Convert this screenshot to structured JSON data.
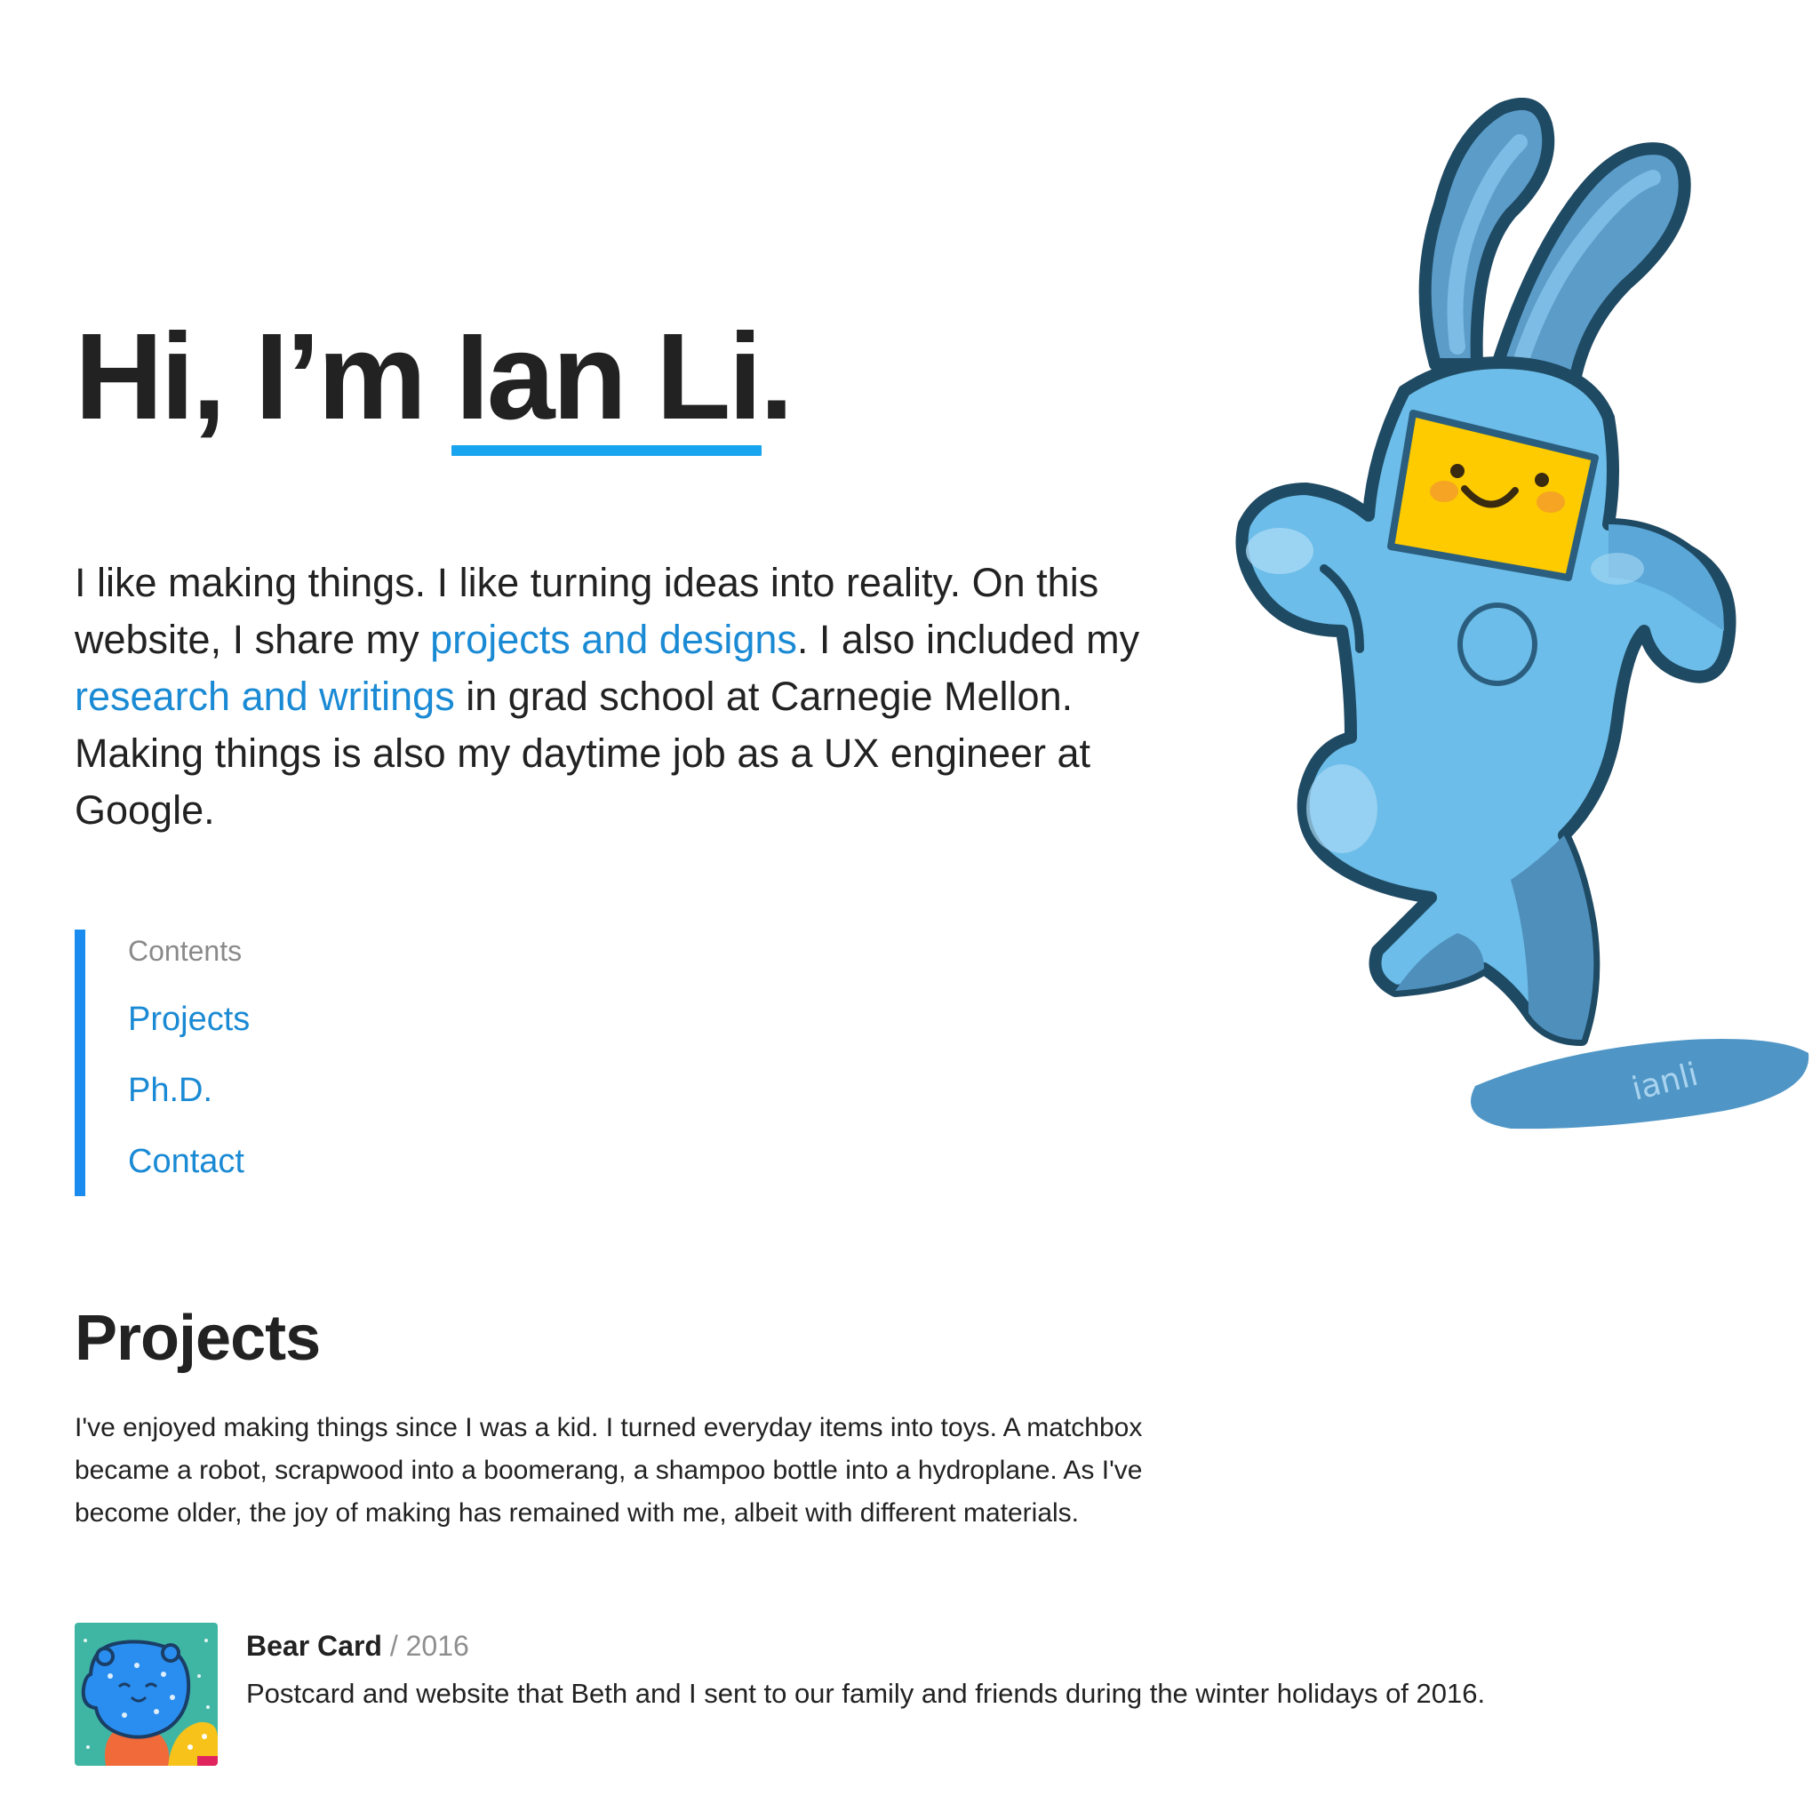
{
  "hero": {
    "greeting": "Hi, I’m ",
    "name": "Ian Li",
    "period": "."
  },
  "intro": {
    "p1": "I like making things. I like turning ideas into reality. On this website, I share my ",
    "link1": "projects and designs",
    "p2": ". I also included my ",
    "link2": "research and writings",
    "p3": " in grad school at Carnegie Mellon. Making things is also my daytime job as a UX engineer at Google."
  },
  "toc": {
    "heading": "Contents",
    "items": [
      {
        "label": "Projects"
      },
      {
        "label": "Ph.D."
      },
      {
        "label": "Contact"
      }
    ]
  },
  "projects": {
    "heading": "Projects",
    "intro": "I've enjoyed making things since I was a kid. I turned everyday items into toys. A matchbox became a robot, scrapwood into a boomerang, a shampoo bottle into a hydroplane. As I've become older, the joy of making has remained with me, albeit with different materials.",
    "items": [
      {
        "title": "Bear Card",
        "separator": " / ",
        "year": "2016",
        "description": "Postcard and website that Beth and I sent to our family and friends during the winter holidays of 2016.",
        "thumb_icon": "bear-card-thumbnail"
      }
    ]
  },
  "mascot": {
    "signature": "ianli",
    "icon": "blue-bunny-mascot-illustration"
  },
  "colors": {
    "accent": "#18a4ee",
    "link": "#1a8ad4",
    "toc_bar": "#1a8cf0",
    "bunny_body": "#6cbde9",
    "bunny_shade": "#5096c4",
    "bunny_outline": "#1f4a63",
    "face_yellow": "#fdcb00",
    "muted_text": "#8e8e8e"
  }
}
